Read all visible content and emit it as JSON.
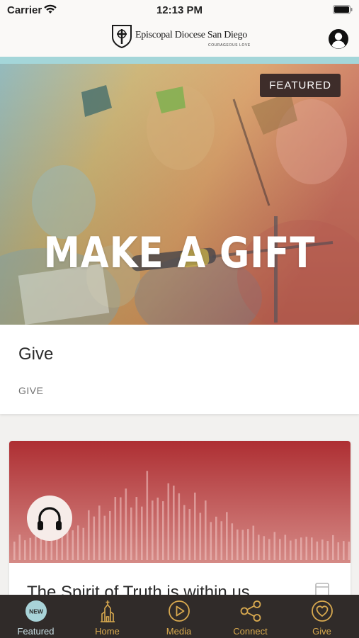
{
  "status_bar": {
    "carrier": "Carrier",
    "time": "12:13 PM"
  },
  "header": {
    "logo_title": "Episcopal Diocese San Diego",
    "logo_tagline": "COURAGEOUS LOVE",
    "icons": {
      "profile": "person-circle-icon"
    }
  },
  "hero": {
    "title": "MAKE A GIFT",
    "badge": "FEATURED",
    "card_title": "Give",
    "card_subtitle": "GIVE"
  },
  "audio_card": {
    "title": "The Spirit of Truth is within us",
    "icons": {
      "play": "headphones-icon",
      "save": "bookmark-icon"
    }
  },
  "tab_bar": {
    "tabs": [
      {
        "label": "Featured",
        "icon": "new-badge-icon",
        "badge": "NEW",
        "active": true
      },
      {
        "label": "Home",
        "icon": "church-icon",
        "active": false
      },
      {
        "label": "Media",
        "icon": "play-circle-icon",
        "active": false
      },
      {
        "label": "Connect",
        "icon": "share-icon",
        "active": false
      },
      {
        "label": "Give",
        "icon": "heart-circle-icon",
        "active": false
      }
    ]
  },
  "colors": {
    "accent_strip": "#a4d6d9",
    "tab_bar": "#302b29",
    "tab_inactive": "#d8a94f",
    "tab_active_badge": "#a8d3d8",
    "audio_card": "#b3373a"
  }
}
